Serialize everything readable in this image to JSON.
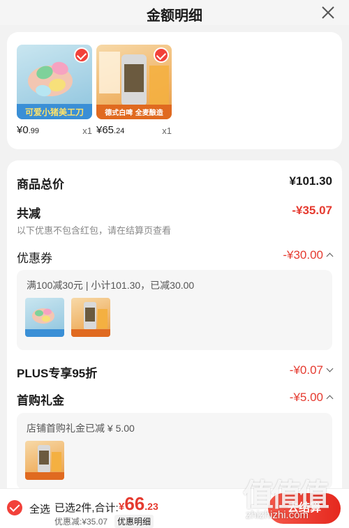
{
  "header": {
    "title": "金额明细"
  },
  "products": [
    {
      "image_label": "可爱小猪美工刀",
      "price_int": "¥0",
      "price_dec": ".99",
      "qty": "x1"
    },
    {
      "image_label": "德式白啤 全麦酿造",
      "price_int": "¥65",
      "price_dec": ".24",
      "qty": "x1"
    }
  ],
  "summary": {
    "total_label": "商品总价",
    "total_value": "¥101.30",
    "reduce_label": "共减",
    "reduce_value": "-¥35.07",
    "reduce_note": "以下优惠不包含红包，请在结算页查看",
    "coupon_label": "优惠券",
    "coupon_value": "-¥30.00",
    "coupon_desc": "满100减30元 | 小计101.30，已减30.00",
    "plus_label": "PLUS专享95折",
    "plus_value": "-¥0.07",
    "first_label": "首购礼金",
    "first_value": "-¥5.00",
    "first_desc": "店铺首购礼金已减 ¥ 5.00"
  },
  "bottom": {
    "select_all": "全选",
    "selected": "已选2件,合计:",
    "total_cur": "¥",
    "total_int": "66",
    "total_dec": ".23",
    "discount": "优惠减:¥35.07",
    "detail": "优惠明细",
    "checkout": "去结算"
  },
  "watermark": {
    "site": "zhizhizhi.com"
  },
  "colors": {
    "accent_red": "#e53a2f",
    "check_red": "#f2413a"
  }
}
